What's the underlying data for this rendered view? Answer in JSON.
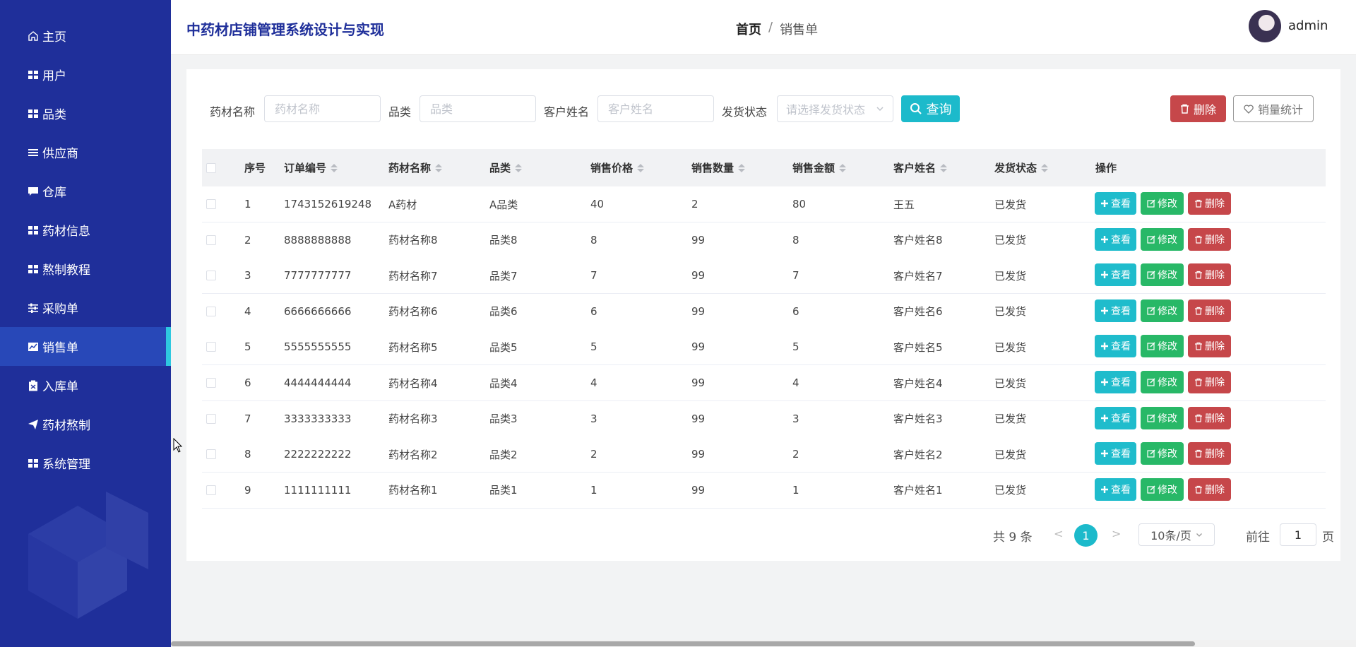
{
  "app": {
    "title": "中药材店铺管理系统设计与实现",
    "username": "admin"
  },
  "breadcrumb": {
    "home": "首页",
    "separator": "/",
    "current": "销售单"
  },
  "sidebar": {
    "items": [
      {
        "label": "主页",
        "icon": "home-icon"
      },
      {
        "label": "用户",
        "icon": "grid-icon"
      },
      {
        "label": "品类",
        "icon": "grid-icon"
      },
      {
        "label": "供应商",
        "icon": "list-icon"
      },
      {
        "label": "仓库",
        "icon": "chat-icon"
      },
      {
        "label": "药材信息",
        "icon": "grid-icon"
      },
      {
        "label": "熬制教程",
        "icon": "grid-icon"
      },
      {
        "label": "采购单",
        "icon": "sliders-icon"
      },
      {
        "label": "销售单",
        "icon": "chart-icon",
        "active": true
      },
      {
        "label": "入库单",
        "icon": "clipboard-icon"
      },
      {
        "label": "药材熬制",
        "icon": "send-icon"
      },
      {
        "label": "系统管理",
        "icon": "grid-icon"
      }
    ]
  },
  "filters": {
    "name_label": "药材名称",
    "name_placeholder": "药材名称",
    "category_label": "品类",
    "category_placeholder": "品类",
    "customer_label": "客户姓名",
    "customer_placeholder": "客户姓名",
    "status_label": "发货状态",
    "status_placeholder": "请选择发货状态",
    "search_button": "查询"
  },
  "toolbar": {
    "delete_label": "删除",
    "stats_label": "销量统计"
  },
  "table": {
    "headers": [
      "序号",
      "订单编号",
      "药材名称",
      "品类",
      "销售价格",
      "销售数量",
      "销售金额",
      "客户姓名",
      "发货状态",
      "操作"
    ],
    "rows": [
      [
        "1",
        "1743152619248",
        "A药材",
        "A品类",
        "40",
        "2",
        "80",
        "王五",
        "已发货"
      ],
      [
        "2",
        "8888888888",
        "药材名称8",
        "品类8",
        "8",
        "99",
        "8",
        "客户姓名8",
        "已发货"
      ],
      [
        "3",
        "7777777777",
        "药材名称7",
        "品类7",
        "7",
        "99",
        "7",
        "客户姓名7",
        "已发货"
      ],
      [
        "4",
        "6666666666",
        "药材名称6",
        "品类6",
        "6",
        "99",
        "6",
        "客户姓名6",
        "已发货"
      ],
      [
        "5",
        "5555555555",
        "药材名称5",
        "品类5",
        "5",
        "99",
        "5",
        "客户姓名5",
        "已发货"
      ],
      [
        "6",
        "4444444444",
        "药材名称4",
        "品类4",
        "4",
        "99",
        "4",
        "客户姓名4",
        "已发货"
      ],
      [
        "7",
        "3333333333",
        "药材名称3",
        "品类3",
        "3",
        "99",
        "3",
        "客户姓名3",
        "已发货"
      ],
      [
        "8",
        "2222222222",
        "药材名称2",
        "品类2",
        "2",
        "99",
        "2",
        "客户姓名2",
        "已发货"
      ],
      [
        "9",
        "1111111111",
        "药材名称1",
        "品类1",
        "1",
        "99",
        "1",
        "客户姓名1",
        "已发货"
      ]
    ],
    "actions": {
      "view": "查看",
      "edit": "修改",
      "delete": "删除"
    }
  },
  "pagination": {
    "total": "共 9 条",
    "prev": "<",
    "next": ">",
    "current_page": "1",
    "page_size": "10条/页",
    "goto_label": "前往",
    "goto_value": "1",
    "page_label": "页"
  },
  "colors": {
    "sidebar": "#1f2f9a",
    "accent": "#1cbacb",
    "danger": "#c6474a",
    "success": "#28b867"
  }
}
